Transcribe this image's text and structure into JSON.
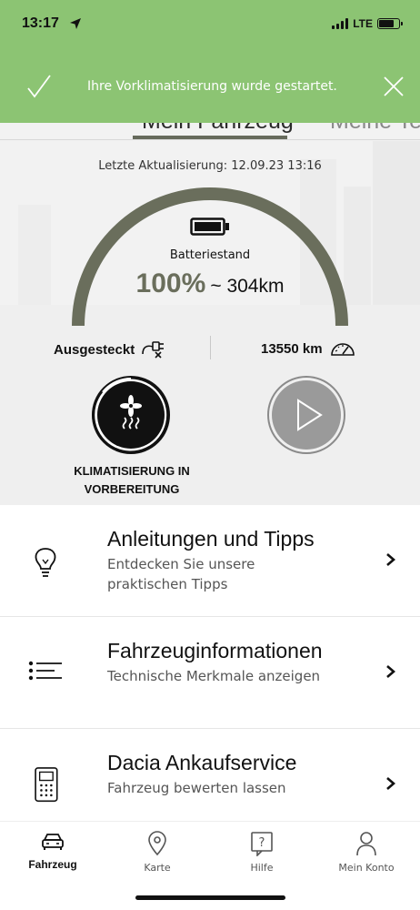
{
  "status_bar": {
    "time": "13:17",
    "network": "LTE",
    "icons": [
      "location-arrow-icon",
      "signal-icon",
      "battery-icon"
    ]
  },
  "toast": {
    "message": "Ihre Vorklimatisierung wurde gestartet.",
    "icons": [
      "check-icon",
      "close-icon"
    ],
    "background_color": "#8cc473"
  },
  "tabs": [
    {
      "label": "Mein Fahrzeug",
      "active": true
    },
    {
      "label": "Meine Ter",
      "active": false
    }
  ],
  "vehicle": {
    "last_update": "Letzte Aktualisierung: 12.09.23 13:16",
    "battery_label": "Batteriestand",
    "battery_percent": "100%",
    "battery_range": "~ 304km",
    "battery_level": 1.0,
    "plug_status": "Ausgesteckt",
    "mileage": "13550 km",
    "climate_label": "KLIMATISIERUNG IN VORBEREITUNG",
    "accent_color": "#6a6e5c"
  },
  "list": [
    {
      "title": "Anleitungen und Tipps",
      "subtitle": "Entdecken Sie unsere praktischen Tipps",
      "icon": "lightbulb-icon"
    },
    {
      "title": "Fahrzeuginformationen",
      "subtitle": "Technische Merkmale anzeigen",
      "icon": "list-icon"
    },
    {
      "title": "Dacia Ankaufservice",
      "subtitle": "Fahrzeug bewerten lassen",
      "icon": "calculator-icon"
    }
  ],
  "bottom_nav": [
    {
      "label": "Fahrzeug",
      "icon": "car-icon",
      "active": true
    },
    {
      "label": "Karte",
      "icon": "map-pin-icon",
      "active": false
    },
    {
      "label": "Hilfe",
      "icon": "help-icon",
      "active": false
    },
    {
      "label": "Mein Konto",
      "icon": "user-icon",
      "active": false
    }
  ]
}
